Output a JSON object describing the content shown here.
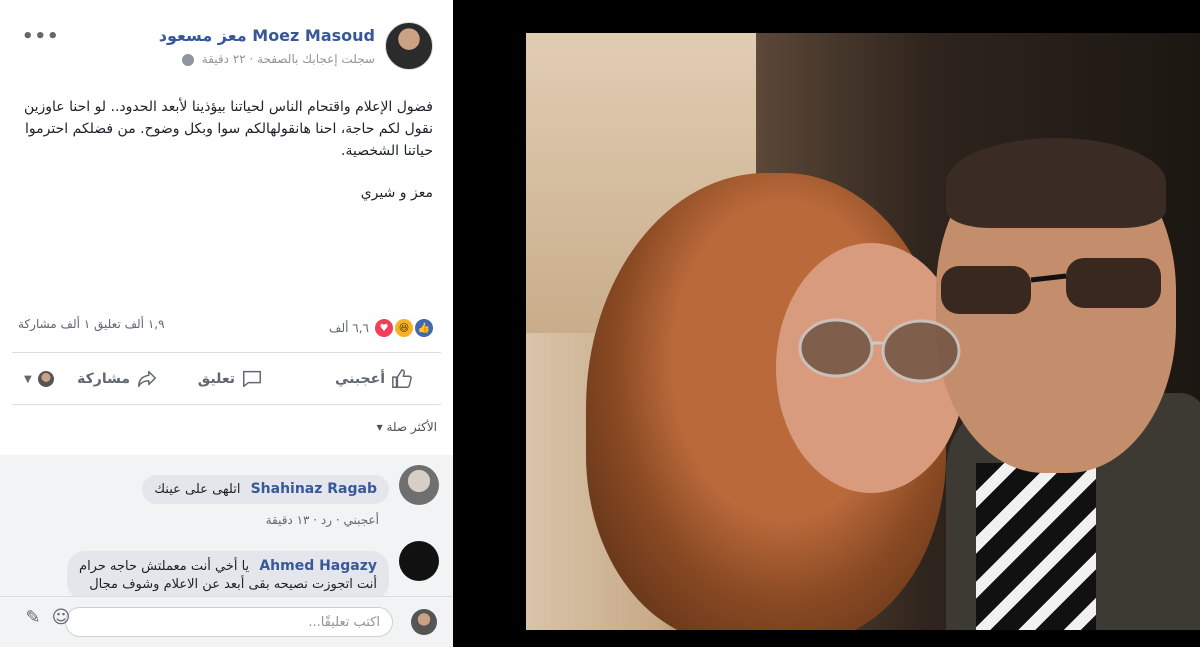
{
  "post": {
    "author": "Moez Masoud معز مسعود",
    "meta": "سجلت إعجابك بالصفحة · ٢٢ دقيقة",
    "more": "•••",
    "text_1": "فضول الإعلام واقتحام الناس لحياتنا بيؤذينا لأبعد الحدود.. لو احنا عاوزين نقول لكم حاجة، احنا هانقولهالكم سوا وبكل وضوح. من فضلكم احترموا حياتنا الشخصية.",
    "text_2": "معز و شيري",
    "reactions_count": "٦,٦ ألف",
    "comments_shares": "١,٩ ألف تعليق   ١ ألف مشاركة",
    "reaction_icons": [
      "like-icon",
      "haha-icon",
      "love-icon"
    ]
  },
  "actions": {
    "like": "أعجبني",
    "comment": "تعليق",
    "share": "مشاركة"
  },
  "sort_label": "الأكثر صلة ▾",
  "comments": [
    {
      "name": "Shahinaz Ragab",
      "text": "اتلهى على عينك",
      "meta": "أعجبني · رد · ١٣ دقيقة"
    },
    {
      "name": "Ahmed Hagazy",
      "text_1": "يا أخي أنت معملتش حاجه حرام",
      "text_2": "أنت اتجوزت نصيحه بقى أبعد عن الاعلام وشوف مجال"
    }
  ],
  "composer": {
    "placeholder": "اكتب تعليقًا..."
  },
  "colors": {
    "link": "#365899",
    "like": "#4267b2",
    "love": "#f33e58",
    "haha": "#f7b125"
  }
}
